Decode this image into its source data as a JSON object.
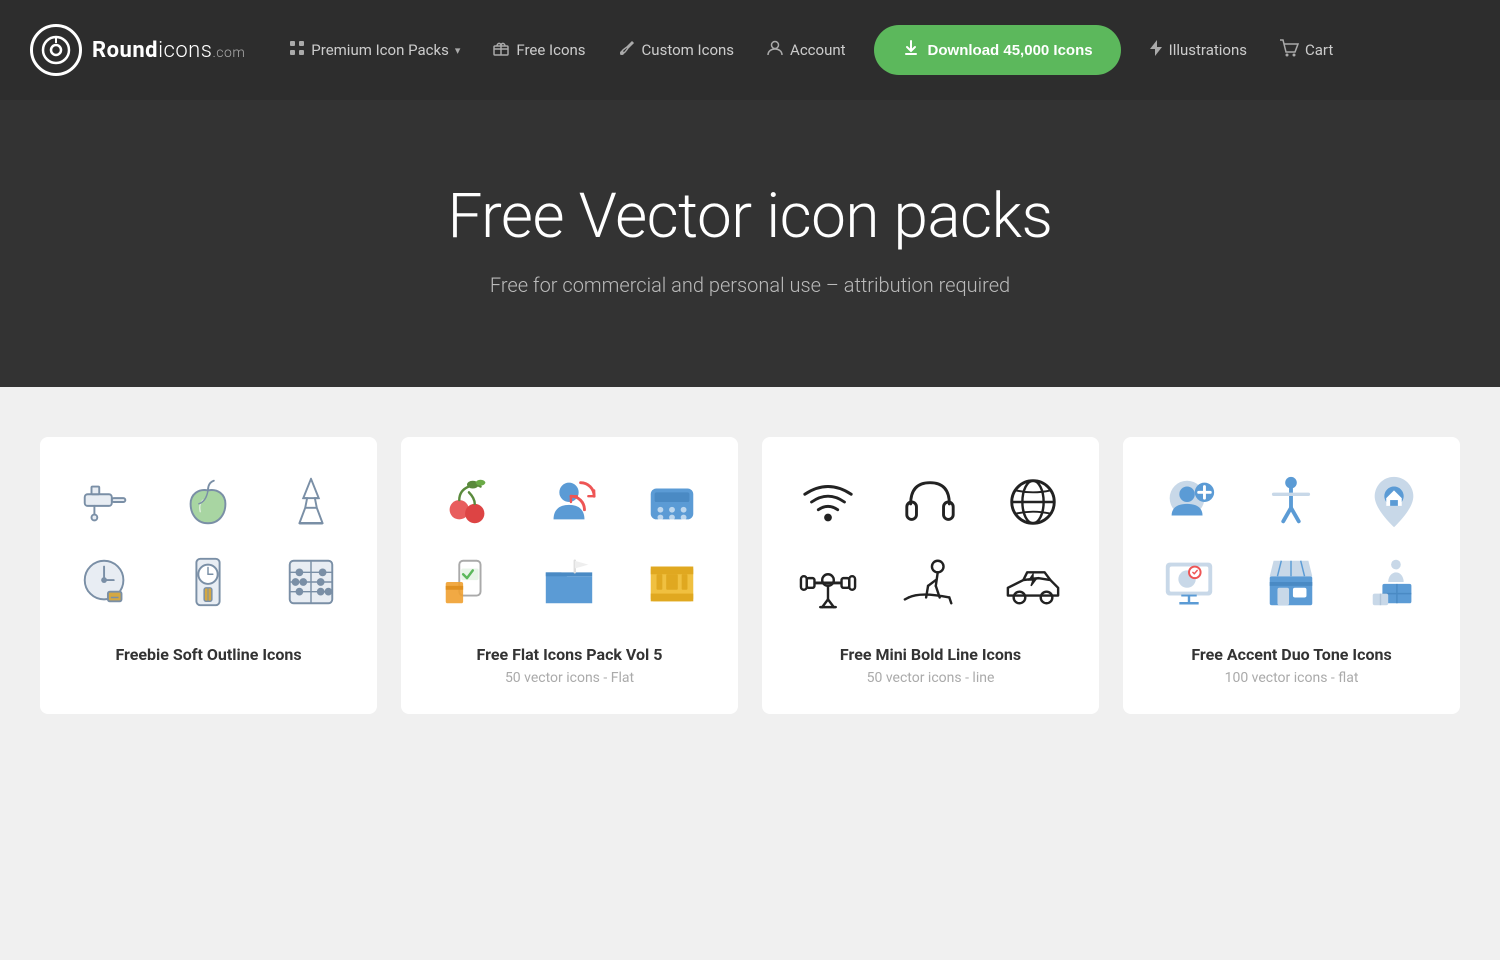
{
  "site": {
    "logo_text_bold": "Round",
    "logo_text_light": "icons",
    "logo_dot": ".com"
  },
  "nav": {
    "items": [
      {
        "id": "premium-icon-packs",
        "label": "Premium Icon Packs",
        "icon": "grid",
        "has_chevron": true
      },
      {
        "id": "free-icons",
        "label": "Free Icons",
        "icon": "gift"
      },
      {
        "id": "custom-icons",
        "label": "Custom Icons",
        "icon": "brush"
      },
      {
        "id": "account",
        "label": "Account",
        "icon": "user"
      }
    ],
    "download_button": "Download 45,000 Icons",
    "illustrations": "Illustrations",
    "cart": "Cart"
  },
  "hero": {
    "title": "Free Vector icon packs",
    "subtitle": "Free for commercial and personal use – attribution required"
  },
  "cards": [
    {
      "id": "freebie-soft-outline",
      "title": "Freebie Soft Outline Icons",
      "subtitle": "",
      "icons": [
        "faucet",
        "apple",
        "eiffel",
        "clock",
        "grandfather-clock",
        "abacus"
      ]
    },
    {
      "id": "free-flat-vol5",
      "title": "Free Flat Icons Pack Vol 5",
      "subtitle": "50 vector icons - Flat",
      "icons": [
        "cherry",
        "person-sync",
        "telephone",
        "checkbox-phone",
        "folder-flag",
        "film-roll"
      ]
    },
    {
      "id": "free-mini-bold-line",
      "title": "Free Mini Bold Line Icons",
      "subtitle": "50 vector icons - line",
      "icons": [
        "wifi",
        "headphones",
        "globe",
        "gym",
        "treadmill",
        "electric-car"
      ]
    },
    {
      "id": "free-accent-duo-tone",
      "title": "Free Accent Duo Tone Icons",
      "subtitle": "100 vector icons - flat",
      "icons": [
        "add-person",
        "accessibility",
        "location-home",
        "monitor-check",
        "shop",
        "boxes"
      ]
    }
  ]
}
